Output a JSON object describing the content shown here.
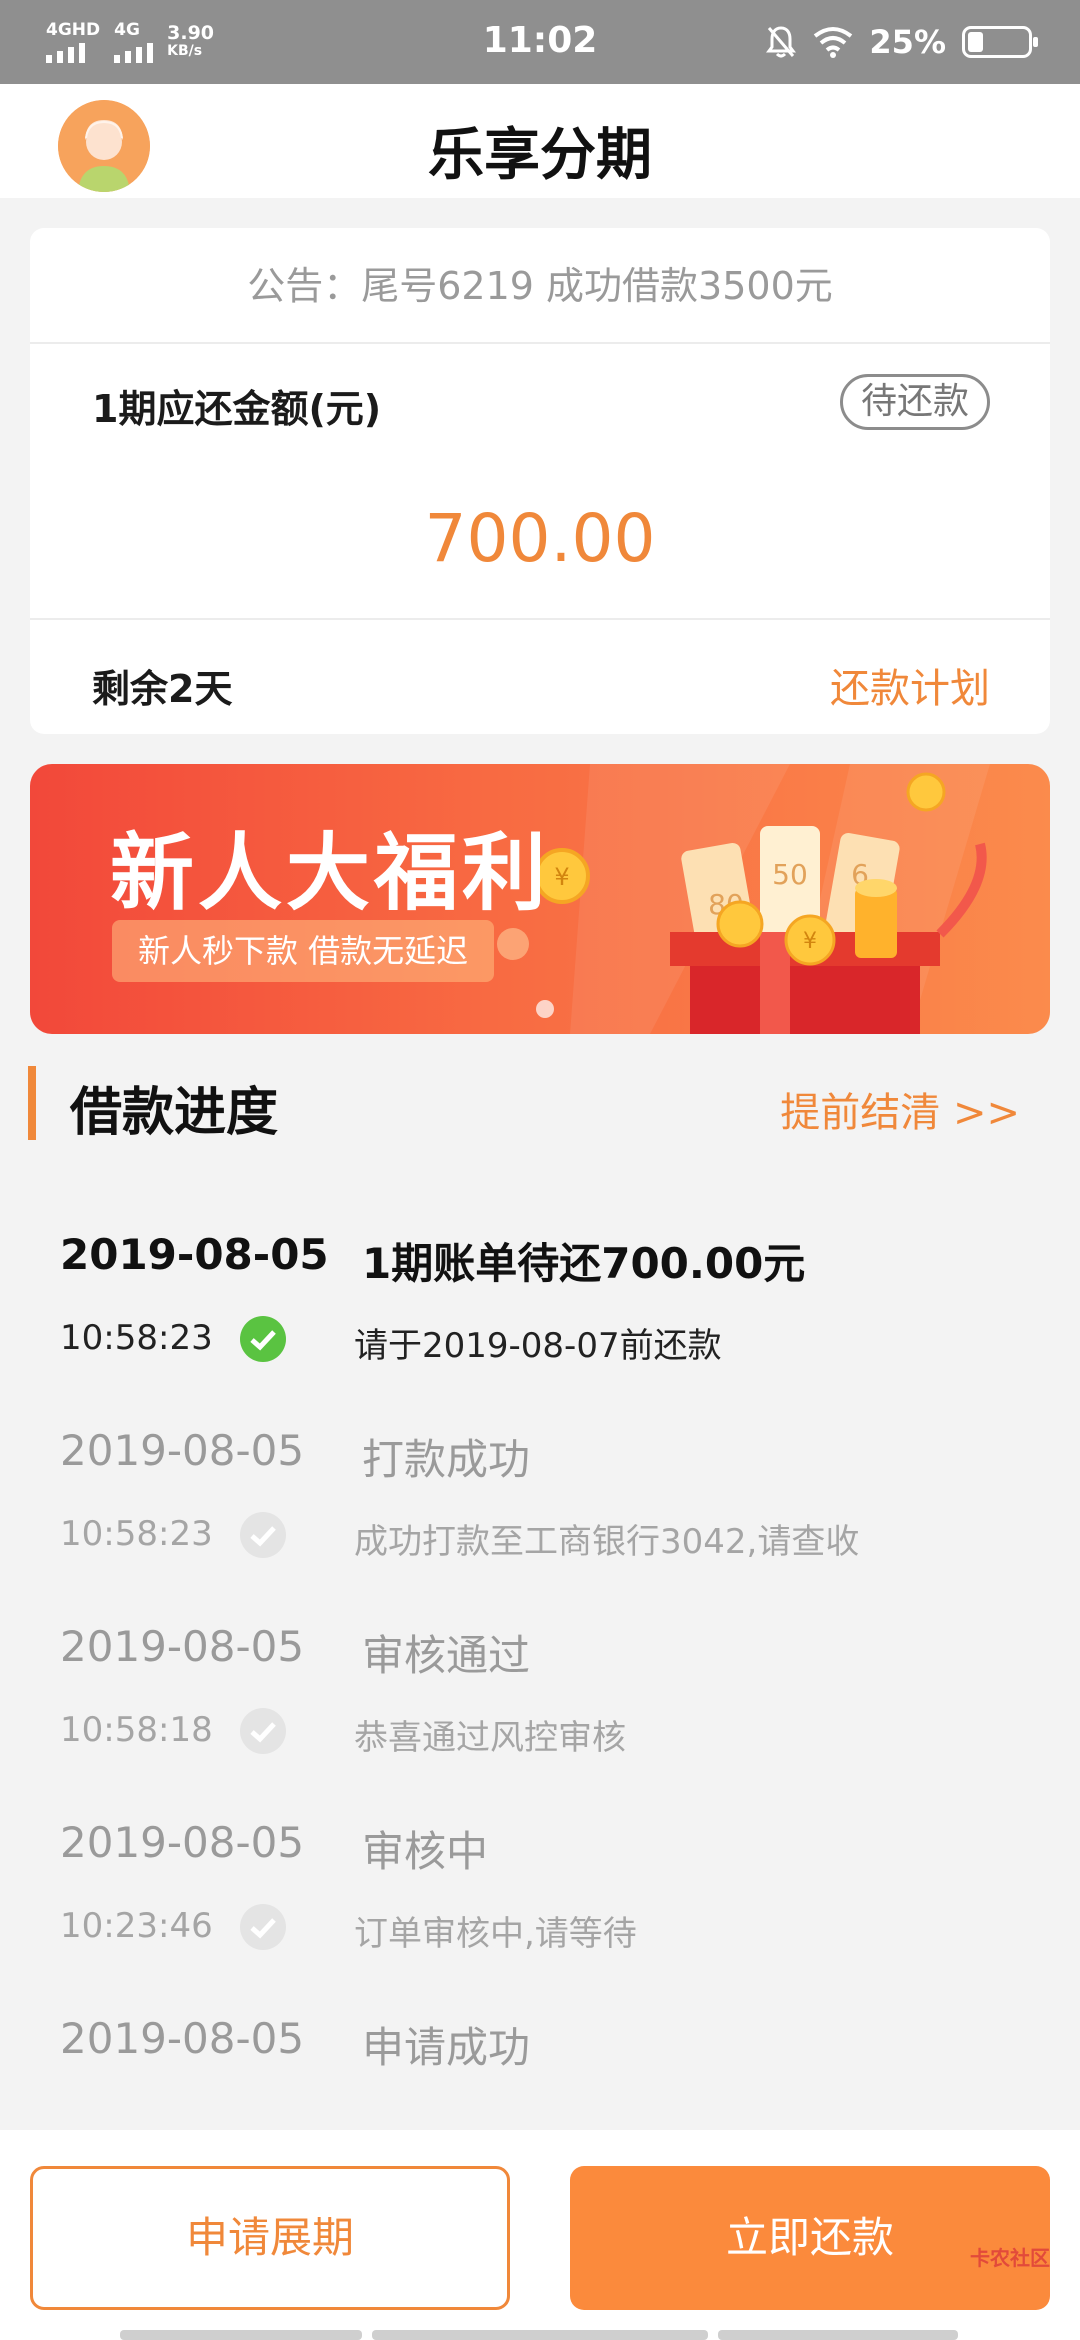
{
  "status_bar": {
    "network_1": "4GHD",
    "network_2": "4G",
    "speed_value": "3.90",
    "speed_unit": "KB/s",
    "time": "11:02",
    "battery": "25%",
    "battery_level": 0.25
  },
  "header": {
    "title": "乐享分期"
  },
  "card": {
    "notice": "公告：尾号6219 成功借款3500元",
    "due_label": "1期应还金额(元)",
    "status": "待还款",
    "amount": "700.00",
    "remaining": "剩余2天",
    "plan_link": "还款计划"
  },
  "banner": {
    "title": "新人大福利",
    "subtitle": "新人秒下款  借款无延迟",
    "ticket_1": "80",
    "ticket_2": "50",
    "ticket_3": "6"
  },
  "progress": {
    "title": "借款进度",
    "settle_link": "提前结清 >>",
    "items": [
      {
        "date": "2019-08-05",
        "time": "10:58:23",
        "status": "1期账单待还700.00元",
        "desc": "请于2019-08-07前还款"
      },
      {
        "date": "2019-08-05",
        "time": "10:58:23",
        "status": "打款成功",
        "desc": "成功打款至工商银行3042,请查收"
      },
      {
        "date": "2019-08-05",
        "time": "10:58:18",
        "status": "审核通过",
        "desc": "恭喜通过风控审核"
      },
      {
        "date": "2019-08-05",
        "time": "10:23:46",
        "status": "审核中",
        "desc": "订单审核中,请等待"
      },
      {
        "date": "2019-08-05",
        "status": "申请成功"
      }
    ]
  },
  "actions": {
    "extend": "申请展期",
    "pay_now": "立即还款"
  },
  "watermark": "卡农社区",
  "colors": {
    "accent": "#f0883a",
    "success": "#5ac341",
    "banner": "#f2483a"
  }
}
